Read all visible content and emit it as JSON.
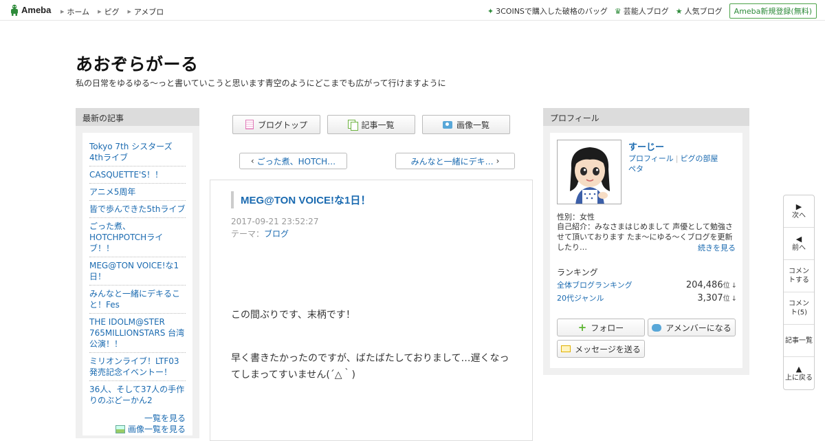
{
  "topbar": {
    "logo_text": "Ameba",
    "nav": [
      "ホーム",
      "ピグ",
      "アメブロ"
    ],
    "right_links": [
      {
        "icon": "sparkle-icon",
        "label": "3COINSで購入した破格のバッグ"
      },
      {
        "icon": "crown-icon",
        "label": "芸能人ブログ"
      },
      {
        "icon": "star-icon",
        "label": "人気ブログ"
      }
    ],
    "signup": "Ameba新規登録(無料)"
  },
  "blog": {
    "title": "あおぞらがーる",
    "description": "私の日常をゆるゆる～っと書いていこうと思います青空のようにどこまでも広がって行けますように"
  },
  "recent": {
    "heading": "最新の記事",
    "items": [
      "Tokyo 7th シスターズ4thライブ",
      "CASQUETTE'S！！",
      "アニメ5周年",
      "皆で歩んできた5thライブ",
      "ごった煮、HOTCHPOTCHライブ！！",
      "MEG@TON VOICE!な1日！",
      "みんなと一緒にデキること！Fes",
      "THE IDOLM@STER 765MILLIONSTARS 台湾公演！！",
      "ミリオンライブ！LTF03発売記念イベントー！",
      "36人、そして37人の手作りのぶどーかん2"
    ],
    "see_all": "一覧を見る",
    "see_images": "画像一覧を見る"
  },
  "toolbar": {
    "blog_top": "ブログトップ",
    "article_list": "記事一覧",
    "image_list": "画像一覧"
  },
  "pager": {
    "prev": "ごった煮、HOTCH…",
    "next": "みんなと一緒にデキ…"
  },
  "article": {
    "title": "MEG@TON VOICE!な1日！",
    "date": "2017-09-21 23:52:27",
    "theme_label": "テーマ：",
    "theme": "ブログ",
    "paragraph1": "この間ぶりです、末柄です！",
    "paragraph2": "早く書きたかったのですが、ばたばたしておりまして…遅くなってしまってすいません(´△｀)"
  },
  "profile": {
    "heading": "プロフィール",
    "name": "すーじー",
    "link_profile": "プロフィール",
    "link_pig": "ピグの部屋",
    "link_peta": "ペタ",
    "gender": "性別：女性",
    "intro": "自己紹介：みなさまはじめまして 声優として勉強させて頂いております たま～にゆる～くブログを更新したり…",
    "more": "続きを見る",
    "ranking_heading": "ランキング",
    "ranks": [
      {
        "label": "全体ブログランキング",
        "value": "204,486",
        "unit": "位",
        "arrow": "↓"
      },
      {
        "label": "20代ジャンル",
        "value": "3,307",
        "unit": "位",
        "arrow": "↓"
      }
    ],
    "follow": "フォロー",
    "amember": "アメンバーになる",
    "message": "メッセージを送る"
  },
  "float_nav": [
    {
      "icon": "▶",
      "label": "次へ"
    },
    {
      "icon": "◀",
      "label": "前へ"
    },
    {
      "icon": "",
      "label": "コメントする"
    },
    {
      "icon": "",
      "label": "コメント(5)"
    },
    {
      "icon": "",
      "label": "記事一覧"
    },
    {
      "icon": "▲",
      "label": "上に戻る"
    }
  ],
  "colors": {
    "link": "#1a6ab0",
    "ameba_green": "#2e8b3a",
    "sidebar_bg": "#f0f0f0",
    "sidebar_head": "#dcdcdc"
  }
}
